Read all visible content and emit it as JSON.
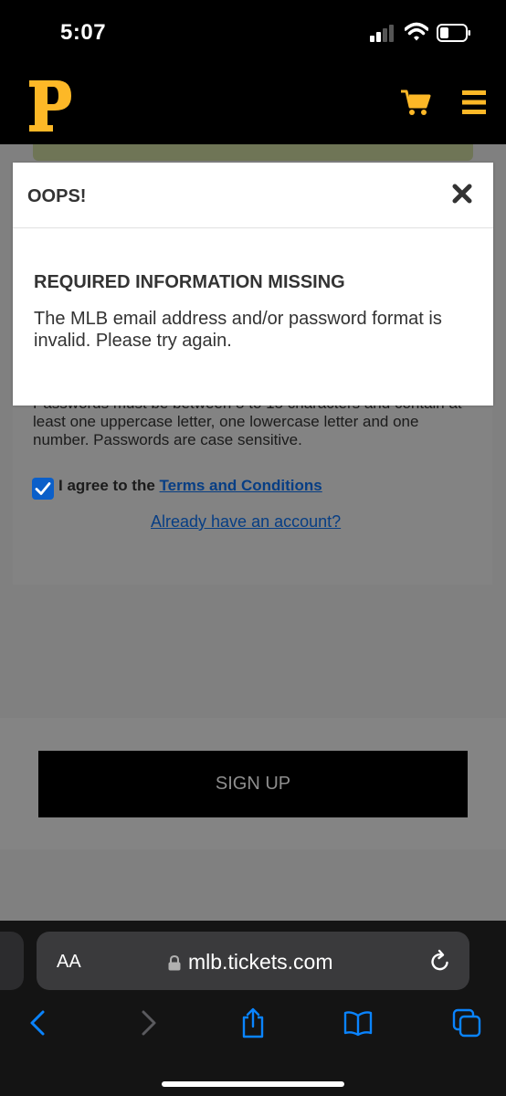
{
  "status_bar": {
    "time": "5:07"
  },
  "header": {
    "logo_icon": "pirates-p-logo",
    "cart_icon": "cart-icon",
    "menu_icon": "hamburger-menu-icon",
    "brand_color": "#fdb827"
  },
  "form": {
    "password_hint": "Passwords must be between 8 to 15 characters and contain at least one uppercase letter, one lowercase letter and one number. Passwords are case sensitive.",
    "agree_prefix": "I agree to the",
    "terms_link": "Terms and Conditions",
    "already_link": "Already have an account?",
    "signup_label": "SIGN UP"
  },
  "modal": {
    "title": "OOPS!",
    "heading": "REQUIRED INFORMATION MISSING",
    "message": "The MLB email address and/or password format is invalid. Please try again."
  },
  "browser": {
    "aa_label": "AA",
    "url": "mlb.tickets.com",
    "accent_color": "#0a84ff"
  }
}
